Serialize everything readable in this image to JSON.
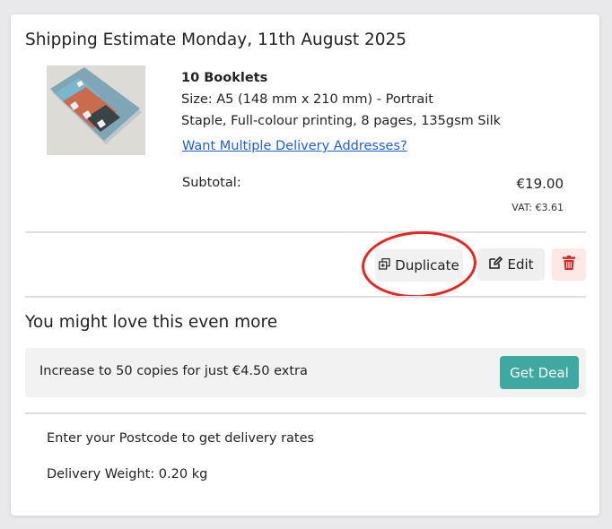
{
  "cart_item": {
    "title": "Shipping Estimate Monday, 11th August 2025",
    "image_icon": "booklet-product-image",
    "product_name": "10 Booklets",
    "size": "Size: A5 (148 mm x 210 mm) - Portrait",
    "spec": "Staple, Full-colour printing, 8 pages, 135gsm Silk",
    "multi_delivery_link": "Want Multiple Delivery Addresses?",
    "subtotal_label": "Subtotal:",
    "subtotal_value": "€19.00",
    "vat": "VAT: €3.61"
  },
  "actions": {
    "duplicate_label": "Duplicate",
    "duplicate_icon": "duplicate-icon",
    "edit_label": "Edit",
    "edit_icon": "pencil-icon",
    "delete_icon": "trash-icon",
    "delete_color": "#e02424",
    "highlight_color": "#e8261f"
  },
  "upsell": {
    "title": "You might love this even more",
    "offer_text": "Increase to 50 copies for just €4.50 extra",
    "button_label": "Get Deal",
    "button_color": "#3fa8a0"
  },
  "delivery": {
    "postcode_prompt": "Enter your Postcode to get delivery rates",
    "weight": "Delivery Weight: 0.20 kg"
  }
}
